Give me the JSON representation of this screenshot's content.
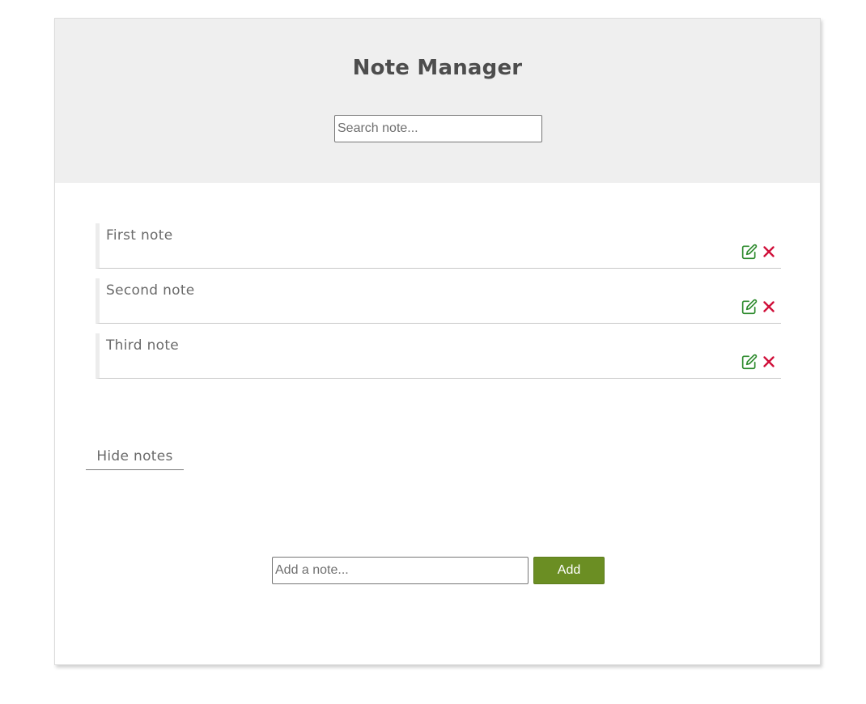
{
  "header": {
    "title": "Note Manager",
    "search_placeholder": "Search note..."
  },
  "notes": [
    {
      "text": "First note"
    },
    {
      "text": "Second note"
    },
    {
      "text": "Third note"
    }
  ],
  "note_actions": {
    "edit_icon": "edit-icon",
    "delete_icon": "close-icon",
    "edit_color": "#2e8b2e",
    "delete_color": "#d0103a"
  },
  "toggle": {
    "label": "Hide notes"
  },
  "add_form": {
    "placeholder": "Add a note...",
    "button_label": "Add",
    "button_color": "#6b8e23"
  }
}
